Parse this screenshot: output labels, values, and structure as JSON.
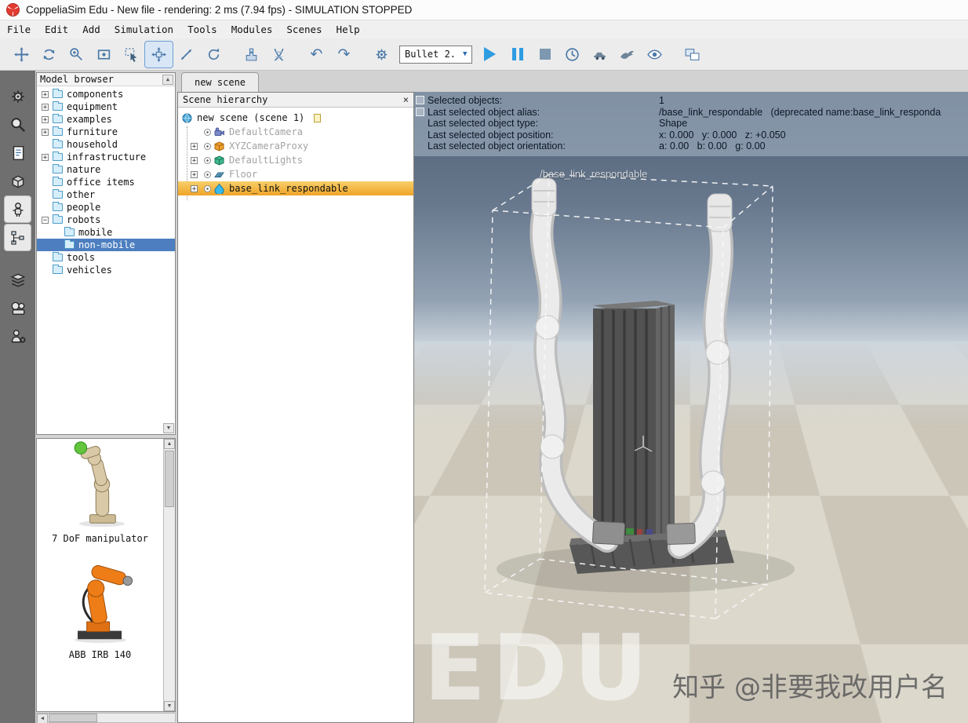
{
  "glyphs": {
    "plus": "+",
    "minus": "−",
    "close": "×",
    "up": "▲",
    "down": "▼",
    "left": "◄",
    "right": "►",
    "undo": "↶",
    "redo": "↷",
    "dropdown": "▼"
  },
  "window": {
    "title": "CoppeliaSim Edu - New file - rendering: 2 ms (7.94 fps) - SIMULATION STOPPED"
  },
  "menu": {
    "items": [
      "File",
      "Edit",
      "Add",
      "Simulation",
      "Tools",
      "Modules",
      "Scenes",
      "Help"
    ]
  },
  "toolbar": {
    "engine_label": "Bullet 2."
  },
  "model_browser": {
    "header": "Model browser",
    "items": [
      {
        "label": "components",
        "expander": "+"
      },
      {
        "label": "equipment",
        "expander": "+"
      },
      {
        "label": "examples",
        "expander": "+"
      },
      {
        "label": "furniture",
        "expander": "+"
      },
      {
        "label": "household",
        "expander": ""
      },
      {
        "label": "infrastructure",
        "expander": "+"
      },
      {
        "label": "nature",
        "expander": ""
      },
      {
        "label": "office items",
        "expander": ""
      },
      {
        "label": "other",
        "expander": ""
      },
      {
        "label": "people",
        "expander": ""
      },
      {
        "label": "robots",
        "expander": "−"
      },
      {
        "label": "mobile",
        "expander": ""
      },
      {
        "label": "non-mobile",
        "expander": ""
      },
      {
        "label": "tools",
        "expander": ""
      },
      {
        "label": "vehicles",
        "expander": ""
      }
    ],
    "models": [
      {
        "label": "7 DoF manipulator"
      },
      {
        "label": "ABB IRB 140"
      }
    ]
  },
  "scene_tabs": {
    "active": "new scene"
  },
  "hierarchy": {
    "header": "Scene hierarchy",
    "items": [
      {
        "label": "new scene (scene 1)",
        "expander": ""
      },
      {
        "label": "DefaultCamera",
        "expander": ""
      },
      {
        "label": "XYZCameraProxy",
        "expander": "+"
      },
      {
        "label": "DefaultLights",
        "expander": "+"
      },
      {
        "label": "Floor",
        "expander": "+"
      },
      {
        "label": "base_link_respondable",
        "expander": "+"
      }
    ]
  },
  "viewport": {
    "info": {
      "rows": [
        {
          "label": "Selected objects:",
          "value": "1"
        },
        {
          "label": "Last selected object alias:",
          "value": "/base_link_respondable   (deprecated name:base_link_responda"
        },
        {
          "label": "Last selected object type:",
          "value": "Shape"
        },
        {
          "label": "Last selected object position:",
          "value": "x: 0.000   y: 0.000   z: +0.050"
        },
        {
          "label": "Last selected object orientation:",
          "value": "a: 0.00   b: 0.00   g: 0.00"
        }
      ]
    },
    "object_label": "/base_link_respondable",
    "watermark": "EDU",
    "credit": "知乎 @非要我改用户名"
  }
}
